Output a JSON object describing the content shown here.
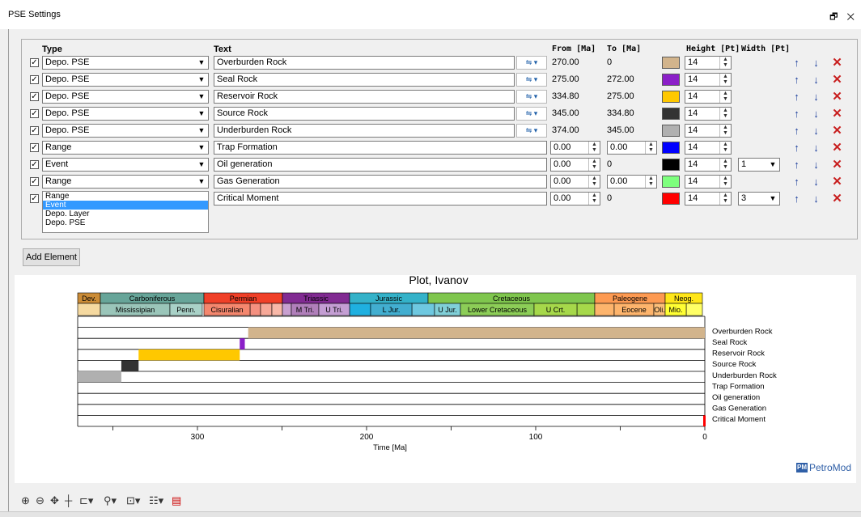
{
  "window": {
    "title": "PSE Settings",
    "controls": "🗗 ✕"
  },
  "headers": {
    "type": "Type",
    "text": "Text",
    "from": "From [Ma]",
    "to": "To [Ma]",
    "height": "Height [Pt]",
    "width": "Width [Pt]"
  },
  "rows": [
    {
      "checked": "✓",
      "type": "Depo. PSE",
      "text": "Overburden Rock",
      "from": "270.00",
      "to": "0",
      "color": "#d2b48c",
      "height": "14",
      "width": ""
    },
    {
      "checked": "✓",
      "type": "Depo. PSE",
      "text": "Seal Rock",
      "from": "275.00",
      "to": "272.00",
      "color": "#8b1fc8",
      "height": "14",
      "width": ""
    },
    {
      "checked": "✓",
      "type": "Depo. PSE",
      "text": "Reservoir Rock",
      "from": "334.80",
      "to": "275.00",
      "color": "#ffc800",
      "height": "14",
      "width": ""
    },
    {
      "checked": "✓",
      "type": "Depo. PSE",
      "text": "Source Rock",
      "from": "345.00",
      "to": "334.80",
      "color": "#333333",
      "height": "14",
      "width": ""
    },
    {
      "checked": "✓",
      "type": "Depo. PSE",
      "text": "Underburden Rock",
      "from": "374.00",
      "to": "345.00",
      "color": "#b0b0b0",
      "height": "14",
      "width": ""
    },
    {
      "checked": "✓",
      "type": "Range",
      "text": "Trap Formation",
      "from": "0.00",
      "to": "0.00",
      "color": "#0000ff",
      "height": "14",
      "width": ""
    },
    {
      "checked": "✓",
      "type": "Event",
      "text": "Oil generation",
      "from": "0.00",
      "to": "0",
      "color": "#000000",
      "height": "14",
      "width": "1"
    },
    {
      "checked": "✓",
      "type": "Range",
      "text": "Gas Generation",
      "from": "0.00",
      "to": "0.00",
      "color": "#7dff7d",
      "height": "14",
      "width": ""
    },
    {
      "checked": "✓",
      "type": "Range",
      "text": "Critical Moment",
      "from": "0.00",
      "to": "0",
      "color": "#ff0000",
      "height": "14",
      "width": "3"
    }
  ],
  "dropdown_options": [
    "Range",
    "Event",
    "Depo. Layer",
    "Depo. PSE"
  ],
  "dropdown_selected": "Event",
  "add_button": "Add Element",
  "plot": {
    "title": "Plot, Ivanov",
    "xlabel": "Time [Ma]",
    "xticks": [
      "300",
      "200",
      "100",
      "0"
    ],
    "periods": [
      {
        "label": "Dev.",
        "color": "#cb8c37"
      },
      {
        "label": "Carboniferous",
        "color": "#67a599"
      },
      {
        "label": "Permian",
        "color": "#f04028"
      },
      {
        "label": "Triassic",
        "color": "#812b92"
      },
      {
        "label": "Jurassic",
        "color": "#34b2c9"
      },
      {
        "label": "Cretaceous",
        "color": "#7fc64e"
      },
      {
        "label": "Paleogene",
        "color": "#fd9a52"
      },
      {
        "label": "Neog.",
        "color": "#ffe619"
      }
    ],
    "epochs": [
      "Mississipian",
      "Penn.",
      "Cisuralian",
      "M Tri.",
      "U Tri.",
      "L Jur.",
      "U Jur.",
      "Lower Cretaceous",
      "U Crt.",
      "Eocene",
      "Oli.",
      "Mio."
    ],
    "row_labels": [
      "Overburden Rock",
      "Seal Rock",
      "Reservoir Rock",
      "Source Rock",
      "Underburden Rock",
      "Trap Formation",
      "Oil generation",
      "Gas Generation",
      "Critical Moment"
    ],
    "logo": "PetroMod",
    "logo_badge": "PM"
  }
}
